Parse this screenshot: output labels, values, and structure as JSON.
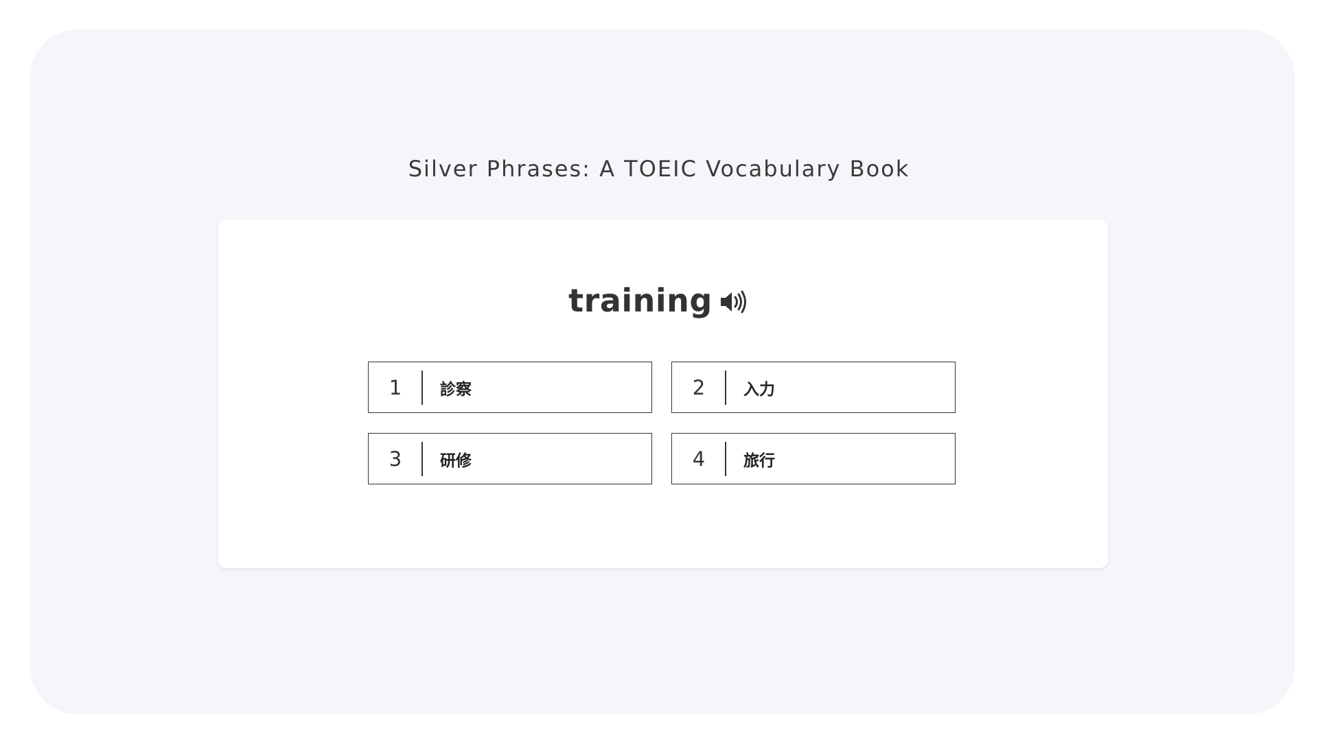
{
  "book_title": "Silver Phrases: A TOEIC Vocabulary Book",
  "question": {
    "word": "training",
    "audio_icon": "speaker-icon"
  },
  "options": [
    {
      "number": "1",
      "text": "診察"
    },
    {
      "number": "2",
      "text": "入力"
    },
    {
      "number": "3",
      "text": "研修"
    },
    {
      "number": "4",
      "text": "旅行"
    }
  ],
  "colors": {
    "background": "#f5f6fa",
    "card": "#ffffff",
    "border": "#333333",
    "text": "#333333"
  }
}
